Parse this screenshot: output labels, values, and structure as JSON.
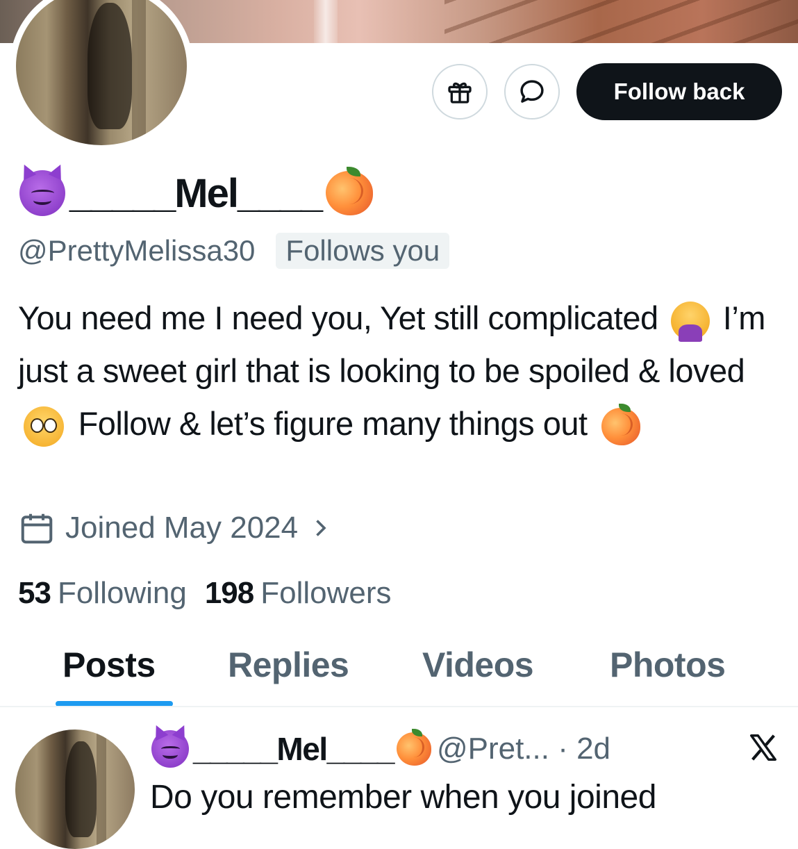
{
  "profile": {
    "display_name_text": "_____Mel____",
    "handle": "@PrettyMelissa30",
    "follows_badge": "Follows you",
    "bio_parts": [
      "You need me I need you, Yet still complicated",
      " I’m just a sweet girl that is looking to be spoiled & loved",
      " Follow & let’s figure many things out"
    ],
    "joined": "Joined May 2024",
    "following_count": "53",
    "following_label": "Following",
    "followers_count": "198",
    "followers_label": "Followers"
  },
  "actions": {
    "follow_back_label": "Follow back",
    "gift_icon": "gift-icon",
    "message_icon": "message-bubble-icon"
  },
  "tabs": [
    "Posts",
    "Replies",
    "Videos",
    "Photos"
  ],
  "active_tab": "Posts",
  "post": {
    "name_text": "_____Mel____",
    "handle_time": "@Pret... · 2d",
    "text": "Do you remember when you joined"
  },
  "colors": {
    "text_primary": "#0f1419",
    "text_secondary": "#536471",
    "accent": "#1d9bf0",
    "button_dark": "#0f1419"
  },
  "emoji_names": [
    "smiling-devil-emoji",
    "peach-emoji",
    "facepalm-emoji",
    "pleading-face-emoji"
  ]
}
